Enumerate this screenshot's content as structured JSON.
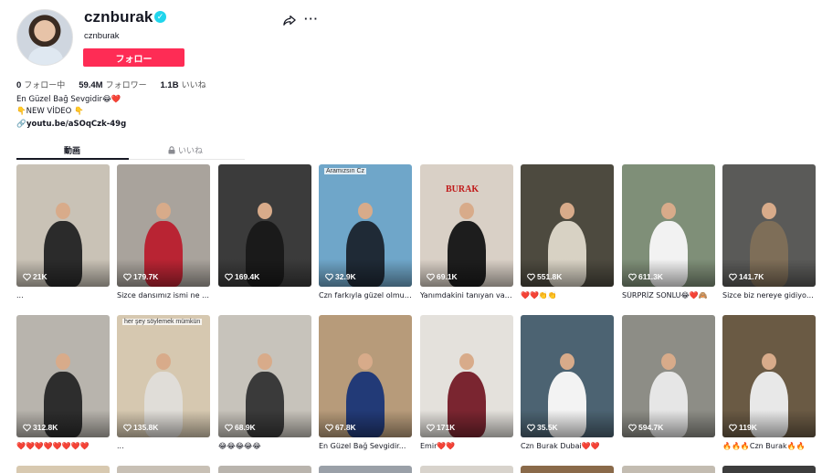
{
  "profile": {
    "username": "cznburak",
    "handle": "cznburak",
    "follow_label": "フォロー",
    "stats": [
      {
        "num": "0",
        "label": "フォロー中"
      },
      {
        "num": "59.4M",
        "label": "フォロワー"
      },
      {
        "num": "1.1B",
        "label": "いいね"
      }
    ],
    "bio_line1": "En Güzel Bağ Sevgidir😂❤️",
    "bio_line2": "👇NEW VİDEO 👇",
    "link": "youtu.be/aSOqCzk-49g"
  },
  "tabs": {
    "videos": "動画",
    "liked": "いいね"
  },
  "videos": [
    {
      "views": "21K",
      "caption": "...",
      "bg": "#c9c2b6",
      "fig": "#2b2b2b"
    },
    {
      "views": "179.7K",
      "caption": "Sizce dansımız ismi ne o...",
      "bg": "#a9a39c",
      "fig": "#b92433"
    },
    {
      "views": "169.4K",
      "caption": "",
      "bg": "#3b3b3b",
      "fig": "#1a1a1a"
    },
    {
      "views": "32.9K",
      "caption": "Czn farkıyla güzel olmuş...",
      "bg": "#6fa6c9",
      "fig": "#1f2a36",
      "overlay": "Aramızsın Cz"
    },
    {
      "views": "69.1K",
      "caption": "Yanımdakini tanıyan var...",
      "bg": "#d9d0c6",
      "fig": "#1d1d1d",
      "sign": "BURAK"
    },
    {
      "views": "551.8K",
      "caption": "❤️❤️👏👏",
      "bg": "#4d4a3f",
      "fig": "#d8d2c4"
    },
    {
      "views": "611.3K",
      "caption": "SÜRPRİZ SONLU😂❤️🙈",
      "bg": "#7f8f78",
      "fig": "#f2f2f2"
    },
    {
      "views": "141.7K",
      "caption": "Sizce biz nereye gidiyor...",
      "bg": "#5a5a58",
      "fig": "#7e6e58"
    },
    {
      "views": "312.8K",
      "caption": "❤️❤️❤️❤️❤️❤️❤️❤️",
      "bg": "#b8b4ad",
      "fig": "#2d2d2d"
    },
    {
      "views": "135.8K",
      "caption": "...",
      "bg": "#d6c8b0",
      "fig": "#e0ddd8",
      "overlay": "her şey söylemek mümkün"
    },
    {
      "views": "68.9K",
      "caption": "😂😂😂😂😂",
      "bg": "#c7c3bb",
      "fig": "#3a3a3a"
    },
    {
      "views": "67.8K",
      "caption": "En Güzel Bağ Sevgidir...",
      "bg": "#b79b7a",
      "fig": "#223a77"
    },
    {
      "views": "171K",
      "caption": "Emir❤️❤️",
      "bg": "#e4e1dc",
      "fig": "#7a2530"
    },
    {
      "views": "35.5K",
      "caption": "Czn Burak Dubai❤️❤️",
      "bg": "#4c6372",
      "fig": "#f3f3f3"
    },
    {
      "views": "594.7K",
      "caption": "",
      "bg": "#8d8d86",
      "fig": "#e6e6e6"
    },
    {
      "views": "119K",
      "caption": "🔥🔥🔥Czn Burak🔥🔥",
      "bg": "#6a5a44",
      "fig": "#e8e8e8"
    }
  ],
  "row3_colors": [
    "#d8c9b0",
    "#c8c0b5",
    "#b9b4ad",
    "#9aa0a8",
    "#d8d3cc",
    "#8a6a4a",
    "#c3bcb1",
    "#3d3d3d"
  ],
  "colors": {
    "accent": "#fe2c55",
    "verified": "#20d5ec"
  }
}
